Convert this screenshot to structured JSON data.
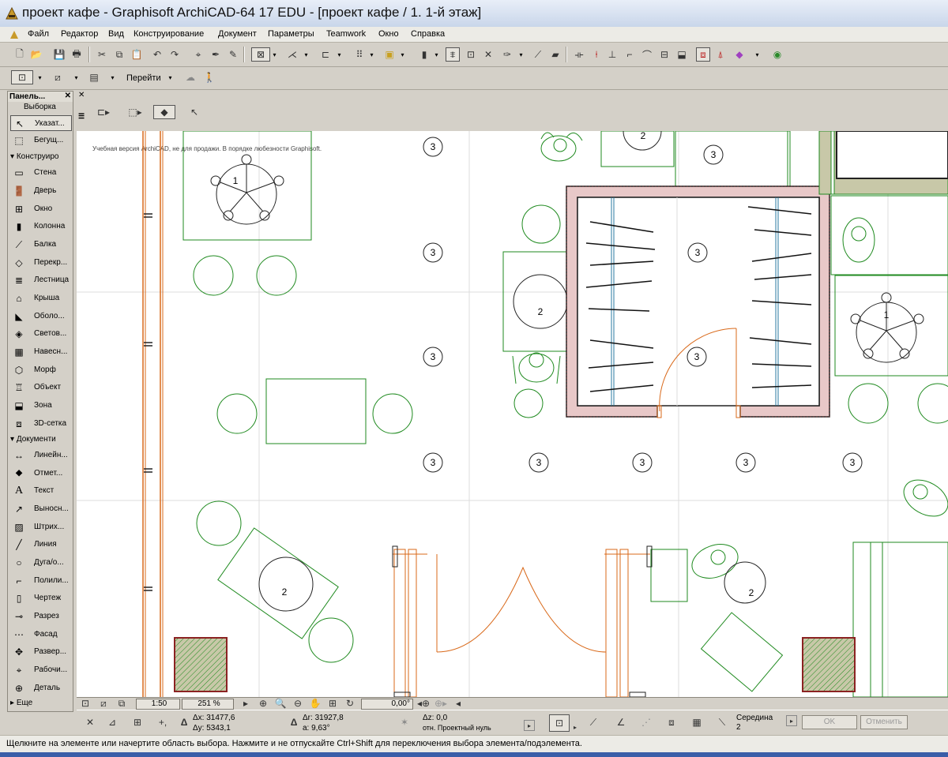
{
  "window": {
    "title": "проект кафе - Graphisoft ArchiCAD-64 17 EDU - [проект кафе / 1. 1-й этаж]"
  },
  "menu": [
    "Файл",
    "Редактор",
    "Вид",
    "Конструирование",
    "Документ",
    "Параметры",
    "Teamwork",
    "Окно",
    "Справка"
  ],
  "toolbar2": {
    "goto_label": "Перейти"
  },
  "palette": {
    "title": "Панель...",
    "selection_header": "Выборка",
    "selection_tools": [
      "Указат...",
      "Бегущ..."
    ],
    "construct_header": "Конструиро",
    "construct_tools": [
      "Стена",
      "Дверь",
      "Окно",
      "Колонна",
      "Балка",
      "Перекр...",
      "Лестница",
      "Крыша",
      "Оболо...",
      "Светов...",
      "Навесн...",
      "Морф",
      "Объект",
      "Зона",
      "3D-сетка"
    ],
    "document_header": "Документи",
    "document_tools": [
      "Линейн...",
      "Отмет...",
      "Текст",
      "Выносн...",
      "Штрих...",
      "Линия",
      "Дуга/о...",
      "Полили...",
      "Чертеж",
      "Разрез",
      "Фасад",
      "Развер...",
      "Рабочи...",
      "Деталь"
    ],
    "more": "Еще"
  },
  "canvas": {
    "watermark": "Учебная версия ArchiCAD, не для продажи. В порядке любезности Graphisoft.",
    "labels": {
      "zone3": "3",
      "zone2": "2",
      "zone1": "1"
    }
  },
  "navbar": {
    "scale": "1:50",
    "zoom": "251 %",
    "angle": "0,00°"
  },
  "coords": {
    "dx": "Δx: 31477,6",
    "dy": "Δy: 5343,1",
    "dr": "Δr: 31927,8",
    "da": "a: 9,63°",
    "dz": "Δz: 0,0",
    "ref": "отн. Проектный нуль",
    "snap_label": "Середина",
    "snap_value": "2",
    "ok": "OK",
    "cancel": "Отменить"
  },
  "status": "Щелкните на элементе или начертите область выбора. Нажмите и не отпускайте Ctrl+Shift для переключения выбора элемента/подэлемента.",
  "colors": {
    "furniture": "#1f8a1f",
    "door": "#d9691a",
    "wall_fill": "#e8c8c8",
    "column_fill": "#c8c8a8",
    "column_border": "#8b2222"
  }
}
